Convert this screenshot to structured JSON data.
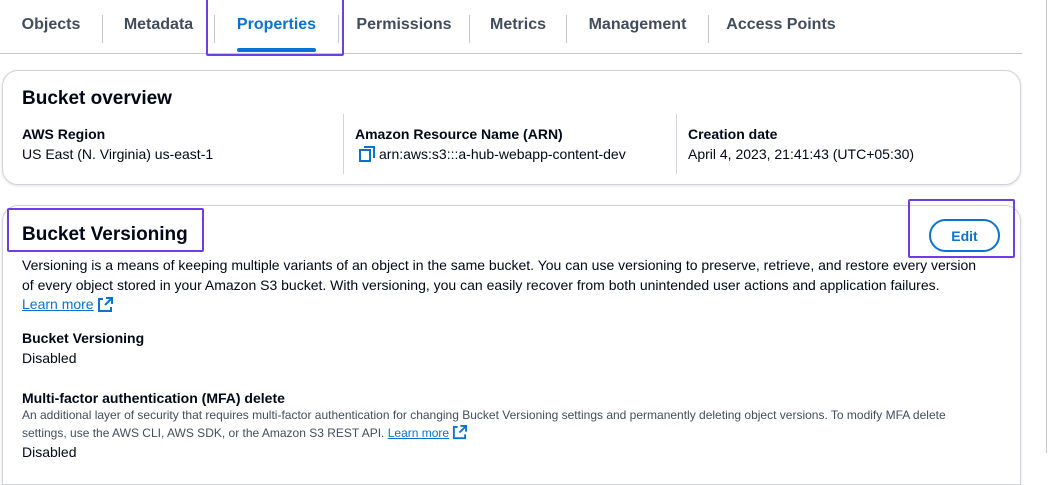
{
  "tabs": [
    {
      "label": "Objects",
      "active": false
    },
    {
      "label": "Metadata",
      "active": false
    },
    {
      "label": "Properties",
      "active": true
    },
    {
      "label": "Permissions",
      "active": false
    },
    {
      "label": "Metrics",
      "active": false
    },
    {
      "label": "Management",
      "active": false
    },
    {
      "label": "Access Points",
      "active": false
    }
  ],
  "overview": {
    "title": "Bucket overview",
    "region_label": "AWS Region",
    "region_value": "US East (N. Virginia) us-east-1",
    "arn_label": "Amazon Resource Name (ARN)",
    "arn_value": "arn:aws:s3:::a-hub-webapp-content-dev",
    "date_label": "Creation date",
    "date_value": "April 4, 2023, 21:41:43 (UTC+05:30)"
  },
  "versioning": {
    "title": "Bucket Versioning",
    "edit_label": "Edit",
    "description": "Versioning is a means of keeping multiple variants of an object in the same bucket. You can use versioning to preserve, retrieve, and restore every version of every object stored in your Amazon S3 bucket. With versioning, you can easily recover from both unintended user actions and application failures.",
    "learn_more": "Learn more",
    "status_label": "Bucket Versioning",
    "status_value": "Disabled",
    "mfa_label": "Multi-factor authentication (MFA) delete",
    "mfa_description": "An additional layer of security that requires multi-factor authentication for changing Bucket Versioning settings and permanently deleting object versions. To modify MFA delete settings, use the AWS CLI, AWS SDK, or the Amazon S3 REST API.",
    "mfa_learn_more": "Learn more",
    "mfa_value": "Disabled"
  },
  "colors": {
    "accent": "#0972d3",
    "highlight": "#6d3ee6",
    "text": "#000716",
    "muted": "#414d5c"
  },
  "icons": {
    "copy": "copy-icon",
    "external": "external-link-icon"
  }
}
